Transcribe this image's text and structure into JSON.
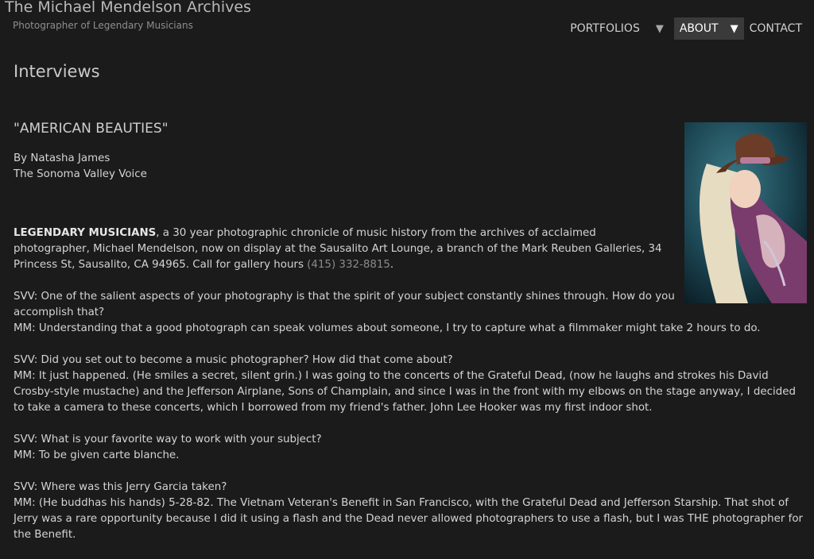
{
  "header": {
    "site_title": "The Michael Mendelson Archives",
    "tagline": "Photographer of Legendary Musicians"
  },
  "nav": {
    "items": [
      {
        "label": "PORTFOLIOS",
        "has_dropdown": true,
        "active": false
      },
      {
        "label": "ABOUT",
        "has_dropdown": true,
        "active": true
      },
      {
        "label": "CONTACT",
        "has_dropdown": false,
        "active": false
      }
    ],
    "caret_glyph": "▼"
  },
  "page": {
    "heading": "Interviews"
  },
  "article": {
    "title": "\"AMERICAN BEAUTIES\"",
    "author": "By Natasha James",
    "publication": "The Sonoma Valley Voice",
    "intro": {
      "bold": "LEGENDARY MUSICIANS",
      "text": ", a 30 year photographic chronicle of music history from the archives of acclaimed photographer, Michael Mendelson, now on display at the Sausalito Art Lounge, a branch of the Mark Reuben Galleries, 34 Princess St, Sausalito, CA 94965. Call for gallery hours ",
      "phone": "(415) 332-8815",
      "tail": "."
    },
    "qa": [
      {
        "q": "SVV: One of the salient aspects of your photography is that the spirit of your subject constantly shines through. How do you accomplish that?",
        "a": "MM: Understanding that a good photograph can speak volumes about someone, I try to capture what a filmmaker might take 2 hours to do."
      },
      {
        "q": "SVV: Did you set out to become a music photographer? How did that come about?",
        "a": "MM: It just happened. (He smiles a secret, silent grin.) I was going to the concerts of the Grateful Dead, (now he laughs and strokes his David Crosby-style mustache) and the Jefferson Airplane, Sons of Champlain, and since I was in the front with my elbows on the stage anyway, I decided to take a camera to these concerts, which I borrowed from my friend's father. John Lee Hooker was my first indoor shot."
      },
      {
        "q": "SVV: What is your favorite way to work with your subject?",
        "a": "MM: To be given carte blanche."
      },
      {
        "q": "SVV: Where was this Jerry Garcia taken?",
        "a": "MM: (He buddhas his hands) 5-28-82. The Vietnam Veteran's Benefit in San Francisco, with the Grateful Dead and Jefferson Starship. That shot of Jerry was a rare opportunity because I did it using a flash and the Dead never allowed photographers to use a flash, but I was THE photographer for the Benefit."
      }
    ]
  },
  "colors": {
    "background": "#1b1b1b",
    "text": "#d4d4d4",
    "nav_active_bg": "#3a3a3a",
    "phone_link": "#8a8a8a"
  }
}
